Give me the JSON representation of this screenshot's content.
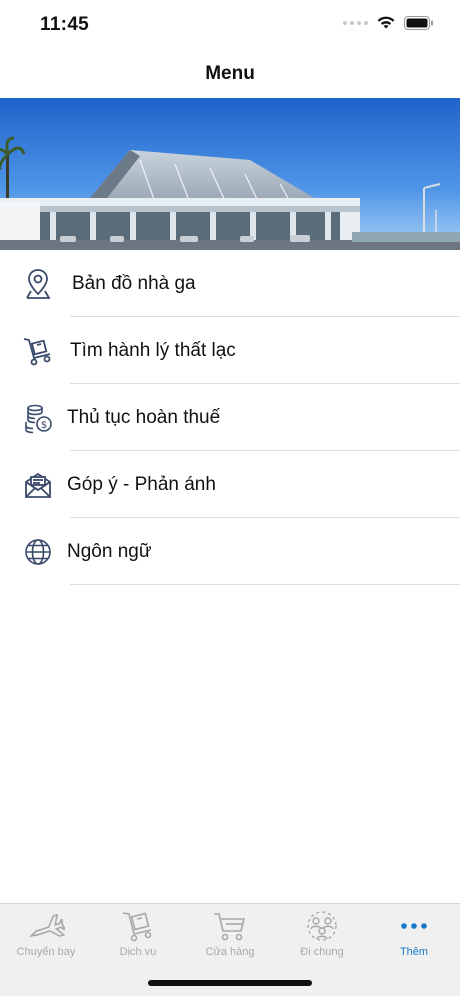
{
  "status_bar": {
    "time": "11:45"
  },
  "nav": {
    "title": "Menu"
  },
  "hero": {
    "description_icon": "airport-terminal-photo"
  },
  "menu": {
    "items": [
      {
        "label": "Bản đồ nhà ga",
        "icon": "location-pin-icon"
      },
      {
        "label": "Tìm hành lý thất lạc",
        "icon": "luggage-cart-icon"
      },
      {
        "label": "Thủ tục hoàn thuế",
        "icon": "coins-refund-icon"
      },
      {
        "label": "Góp ý - Phản ánh",
        "icon": "mail-icon"
      },
      {
        "label": "Ngôn ngữ",
        "icon": "globe-icon"
      }
    ]
  },
  "tabs": [
    {
      "label": "Chuyến bay",
      "icon": "airplane-icon",
      "active": false
    },
    {
      "label": "Dịch vụ",
      "icon": "service-cart-icon",
      "active": false
    },
    {
      "label": "Cửa hàng",
      "icon": "shopping-cart-icon",
      "active": false
    },
    {
      "label": "Đi chung",
      "icon": "group-icon",
      "active": false
    },
    {
      "label": "Thêm",
      "icon": "more-dots-icon",
      "active": true
    }
  ],
  "colors": {
    "accent": "#1677c8",
    "inactive": "#a8a8a8",
    "icon_stroke": "#3a4a6b"
  }
}
